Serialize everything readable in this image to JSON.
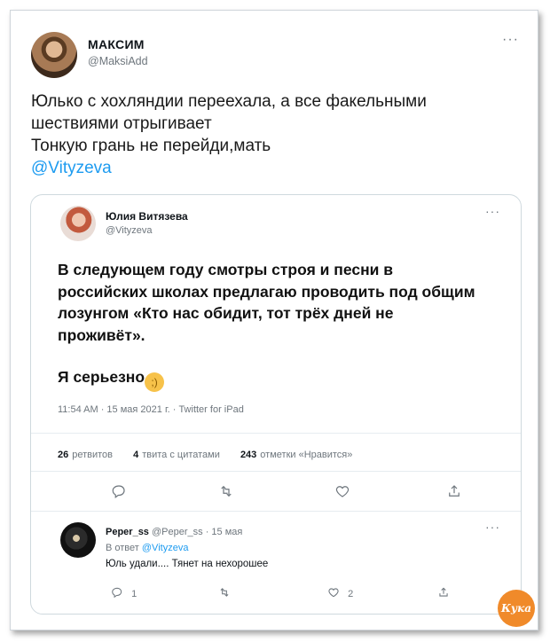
{
  "tweet": {
    "author_name": "МАКСИМ",
    "author_handle": "@MaksiAdd",
    "more": "···",
    "text_line1": "Юлько с хохляндии переехала, а все факельными",
    "text_line2": "шествиями отрыгивает",
    "text_line3": "Тонкую грань не перейди,мать",
    "mention": "@Vityzeva"
  },
  "quote": {
    "author_name": "Юлия Витязева",
    "author_handle": "@Vityzeva",
    "more": "···",
    "body": "В следующем году смотры строя и песни в российских школах предлагаю проводить под общим лозунгом «Кто нас обидит, тот трёх дней не проживёт».",
    "serious": "Я серьезно",
    "emoji_icon": "winking-face-emoji",
    "meta": "11:54 AM · 15 мая 2021 г. · Twitter for iPad",
    "stats": {
      "retweets_count": "26",
      "retweets_label": "ретвитов",
      "quotes_count": "4",
      "quotes_label": "твита с цитатами",
      "likes_count": "243",
      "likes_label": "отметки «Нравится»"
    },
    "actions": [
      "reply-icon",
      "retweet-icon",
      "like-icon",
      "share-icon"
    ]
  },
  "reply": {
    "author_name": "Peper_ss",
    "author_handle": "@Peper_ss",
    "date": "· 15 мая",
    "more": "···",
    "reply_to_prefix": "В ответ",
    "reply_to_handle": "@Vityzeva",
    "text": "Юль удали.... Тянет на нехорошее",
    "reply_count": "1",
    "like_count": "2"
  },
  "watermark": "Кука",
  "colors": {
    "accent": "#1d9bf0",
    "muted": "#6e767d",
    "logo": "#f08a2a"
  }
}
